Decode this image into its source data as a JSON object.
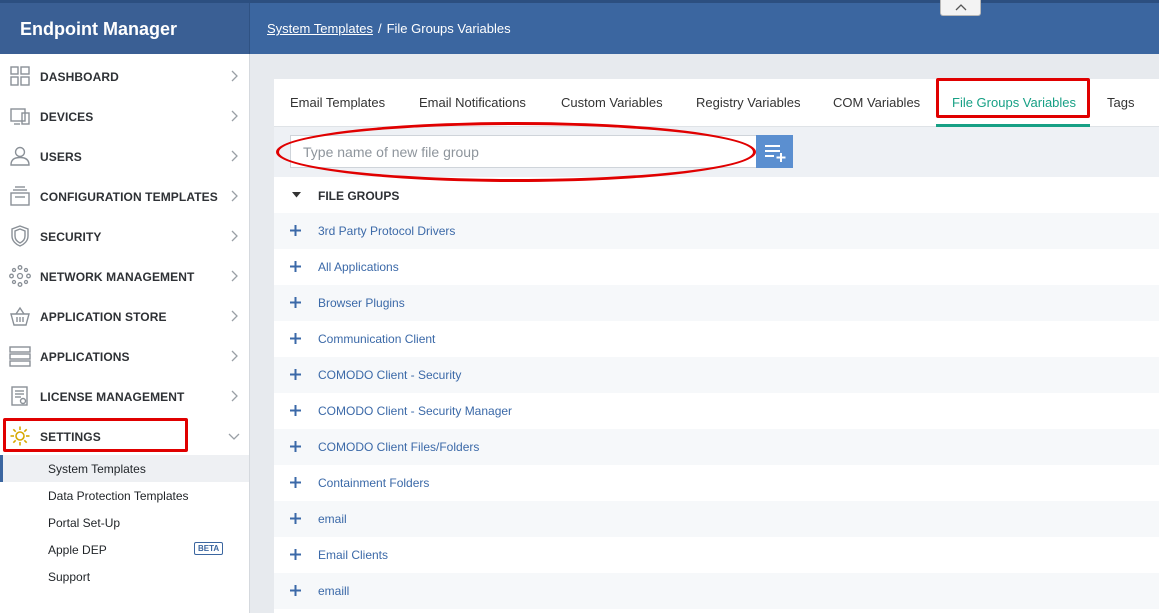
{
  "app": {
    "title": "Endpoint Manager"
  },
  "breadcrumb": {
    "parent": "System Templates",
    "separator": "/",
    "current": "File Groups Variables"
  },
  "sidebar": {
    "items": [
      {
        "label": "DASHBOARD",
        "icon": "dashboard-icon"
      },
      {
        "label": "DEVICES",
        "icon": "devices-icon"
      },
      {
        "label": "USERS",
        "icon": "user-icon"
      },
      {
        "label": "CONFIGURATION TEMPLATES",
        "icon": "templates-icon"
      },
      {
        "label": "SECURITY",
        "icon": "shield-icon"
      },
      {
        "label": "NETWORK MANAGEMENT",
        "icon": "network-icon"
      },
      {
        "label": "APPLICATION STORE",
        "icon": "basket-icon"
      },
      {
        "label": "APPLICATIONS",
        "icon": "applications-icon"
      },
      {
        "label": "LICENSE MANAGEMENT",
        "icon": "license-icon"
      },
      {
        "label": "SETTINGS",
        "icon": "gear-icon"
      }
    ],
    "submenu": [
      {
        "label": "System Templates"
      },
      {
        "label": "Data Protection Templates"
      },
      {
        "label": "Portal Set-Up"
      },
      {
        "label": "Apple DEP",
        "badge": "BETA"
      },
      {
        "label": "Support"
      }
    ]
  },
  "tabs": [
    {
      "label": "Email Templates"
    },
    {
      "label": "Email Notifications"
    },
    {
      "label": "Custom Variables"
    },
    {
      "label": "Registry Variables"
    },
    {
      "label": "COM Variables"
    },
    {
      "label": "File Groups Variables",
      "active": true
    },
    {
      "label": "Tags"
    }
  ],
  "search": {
    "placeholder": "Type name of new file group",
    "value": ""
  },
  "file_groups": {
    "header": "FILE GROUPS",
    "items": [
      "3rd Party Protocol Drivers",
      "All Applications",
      "Browser Plugins",
      "Communication Client",
      "COMODO Client - Security",
      "COMODO Client - Security Manager",
      "COMODO Client Files/Folders",
      "Containment Folders",
      "email",
      "Email Clients",
      "emaill"
    ]
  },
  "colors": {
    "header": "#3b66a0",
    "accent": "#17a085",
    "link": "#3b69a8",
    "highlight": "#e00000"
  }
}
